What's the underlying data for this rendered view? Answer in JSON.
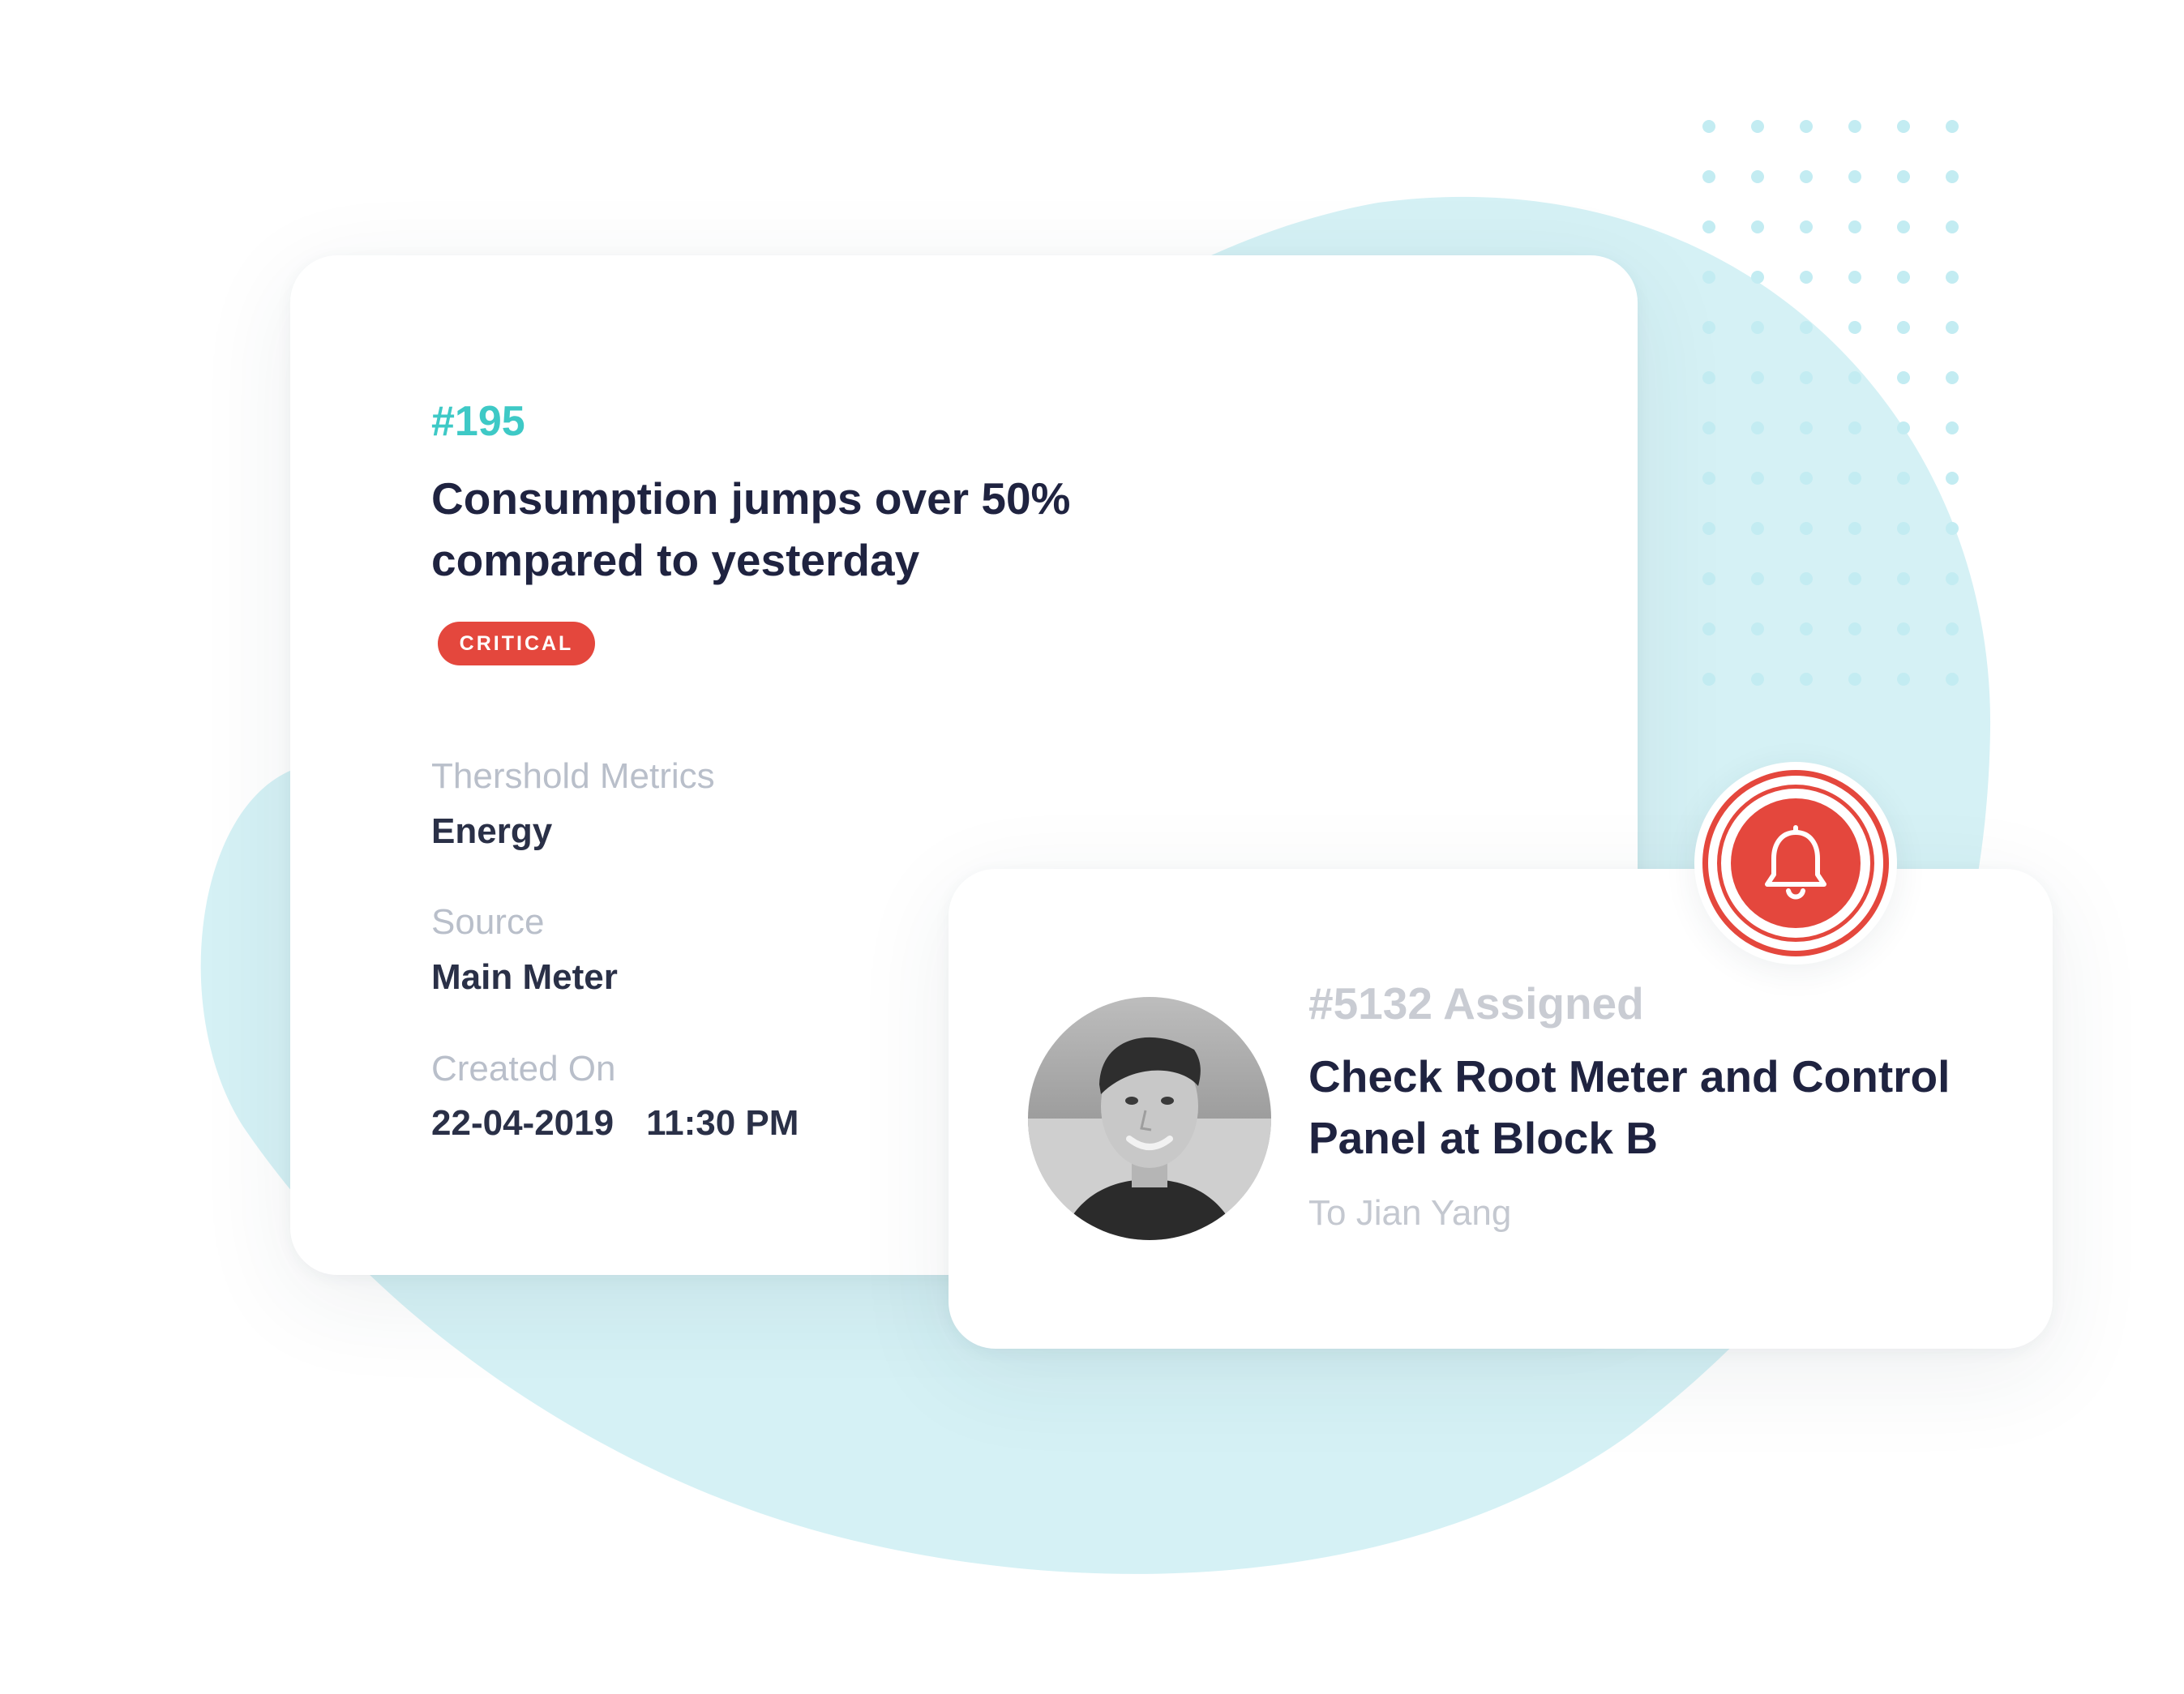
{
  "colors": {
    "accent": "#3ec9c6",
    "critical": "#e4473d",
    "blob": "#d5f1f5",
    "dots": "#c3ecf2",
    "title_text": "#1f2340"
  },
  "alert_card": {
    "id": "#195",
    "title": "Consumption jumps over 50% compared to yesterday",
    "badge": "CRITICAL",
    "fields": {
      "threshold_label": "Thershold Metrics",
      "threshold_value": "Energy",
      "source_label": "Source",
      "source_value": "Main Meter",
      "created_label": "Created On",
      "created_date": "22-04-2019",
      "created_time": "11:30 PM"
    }
  },
  "task_card": {
    "id": "#5132 Assigned",
    "title": "Check Root Meter and Control Panel at Block B",
    "assignee": "To Jian Yang"
  },
  "icons": {
    "notification": "bell-icon",
    "assignee_photo": "avatar"
  }
}
